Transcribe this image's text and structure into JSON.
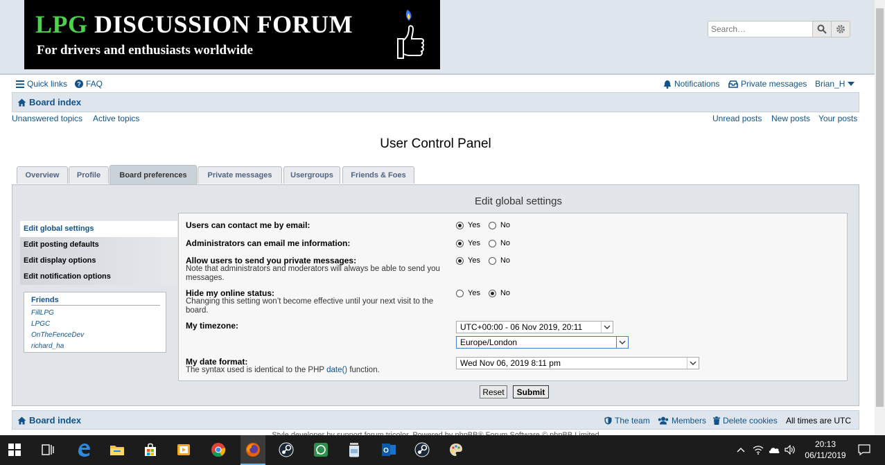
{
  "logo": {
    "title_green": "LPG",
    "title_rest": " DISCUSSION FORUM",
    "subtitle": "For drivers and enthusiasts worldwide"
  },
  "search": {
    "placeholder": "Search…"
  },
  "navbar": {
    "quick_links": "Quick links",
    "faq": "FAQ",
    "notifications": "Notifications",
    "private_messages": "Private messages",
    "user": "Brian_H"
  },
  "breadcrumb": {
    "board_index": "Board index"
  },
  "quick_links": {
    "unanswered": "Unanswered topics",
    "active": "Active topics",
    "unread": "Unread posts",
    "new": "New posts",
    "yours": "Your posts"
  },
  "page_title": "User Control Panel",
  "tabs": [
    "Overview",
    "Profile",
    "Board preferences",
    "Private messages",
    "Usergroups",
    "Friends & Foes"
  ],
  "panel_title": "Edit global settings",
  "menu": [
    "Edit global settings",
    "Edit posting defaults",
    "Edit display options",
    "Edit notification options"
  ],
  "friends": {
    "header": "Friends",
    "list": [
      "FillLPG",
      "LPGC",
      "OnTheFenceDev",
      "richard_ha"
    ]
  },
  "form": {
    "email_label": "Users can contact me by email:",
    "admin_label": "Administrators can email me information:",
    "pm_label": "Allow users to send you private messages:",
    "pm_explain": "Note that administrators and moderators will always be able to send you messages.",
    "hide_label": "Hide my online status:",
    "hide_explain": "Changing this setting won’t become effective until your next visit to the board.",
    "tz_label": "My timezone:",
    "tz_value": "UTC+00:00 - 06 Nov 2019, 20:11",
    "tz_zone": "Europe/London",
    "date_label": "My date format:",
    "date_explain_pre": "The syntax used is identical to the PHP ",
    "date_explain_link": "date()",
    "date_explain_post": " function.",
    "date_value": "Wed Nov 06, 2019 8:11 pm",
    "yes": "Yes",
    "no": "No"
  },
  "buttons": {
    "reset": "Reset",
    "submit": "Submit"
  },
  "footer": {
    "board_index": "Board index",
    "team": "The team",
    "members": "Members",
    "delete_cookies": "Delete cookies",
    "times": "All times are UTC"
  },
  "credit": "Style developer by support forum tricolor, Powered by phpBB® Forum Software © phpBB Limited",
  "taskbar": {
    "time": "20:13",
    "date": "06/11/2019"
  }
}
